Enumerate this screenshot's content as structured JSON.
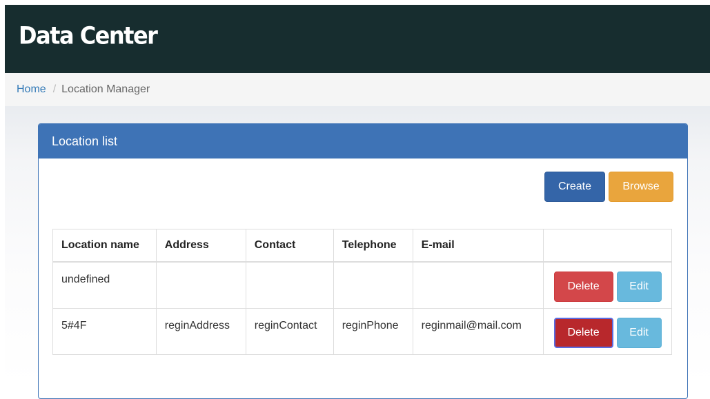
{
  "navbar": {
    "brand": "Data Center"
  },
  "breadcrumb": {
    "home": "Home",
    "separator": "/",
    "current": "Location Manager"
  },
  "panel": {
    "title": "Location list",
    "create_label": "Create",
    "browse_label": "Browse"
  },
  "table": {
    "headers": [
      "Location name",
      "Address",
      "Contact",
      "Telephone",
      "E-mail",
      ""
    ],
    "rows": [
      {
        "name": "undefined",
        "address": "",
        "contact": "",
        "telephone": "",
        "email": "",
        "delete_label": "Delete",
        "edit_label": "Edit"
      },
      {
        "name": "5#4F",
        "address": "reginAddress",
        "contact": "reginContact",
        "telephone": "reginPhone",
        "email": "reginmail@mail.com",
        "delete_label": "Delete",
        "edit_label": "Edit"
      }
    ]
  },
  "colors": {
    "navbar_bg": "#172d2f",
    "panel_primary": "#3e73b6",
    "create": "#3465a8",
    "browse": "#e9a53d",
    "delete": "#d3474a",
    "edit": "#68b9dd"
  }
}
